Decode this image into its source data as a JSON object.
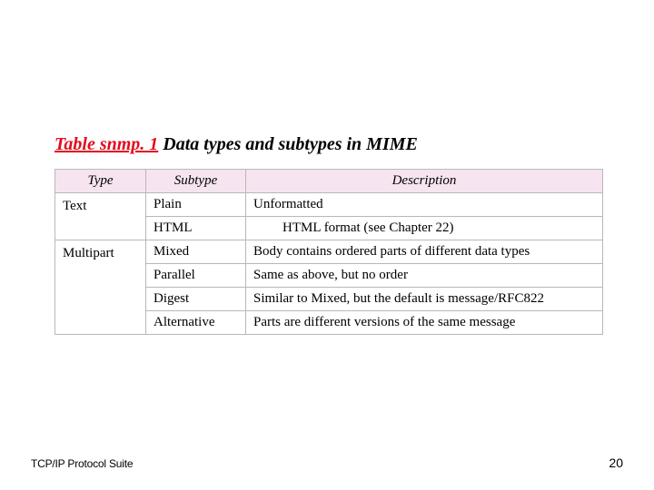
{
  "title": {
    "ref": "Table snmp. 1",
    "rest": "  Data types and subtypes in MIME"
  },
  "table": {
    "headers": {
      "type": "Type",
      "subtype": "Subtype",
      "description": "Description"
    },
    "groups": [
      {
        "type": "Text",
        "rows": [
          {
            "subtype": "Plain",
            "description": "Unformatted",
            "indent": false
          },
          {
            "subtype": "HTML",
            "description": "HTML format (see Chapter 22)",
            "indent": true
          }
        ]
      },
      {
        "type": "Multipart",
        "rows": [
          {
            "subtype": "Mixed",
            "description": "Body contains ordered parts of different data types",
            "indent": false
          },
          {
            "subtype": "Parallel",
            "description": "Same as above, but no order",
            "indent": false
          },
          {
            "subtype": "Digest",
            "description": "Similar to Mixed, but the default is message/RFC822",
            "indent": false
          },
          {
            "subtype": "Alternative",
            "description": "Parts are different versions of the same message",
            "indent": false
          }
        ]
      }
    ]
  },
  "footer": {
    "left": "TCP/IP Protocol Suite",
    "page": "20"
  }
}
